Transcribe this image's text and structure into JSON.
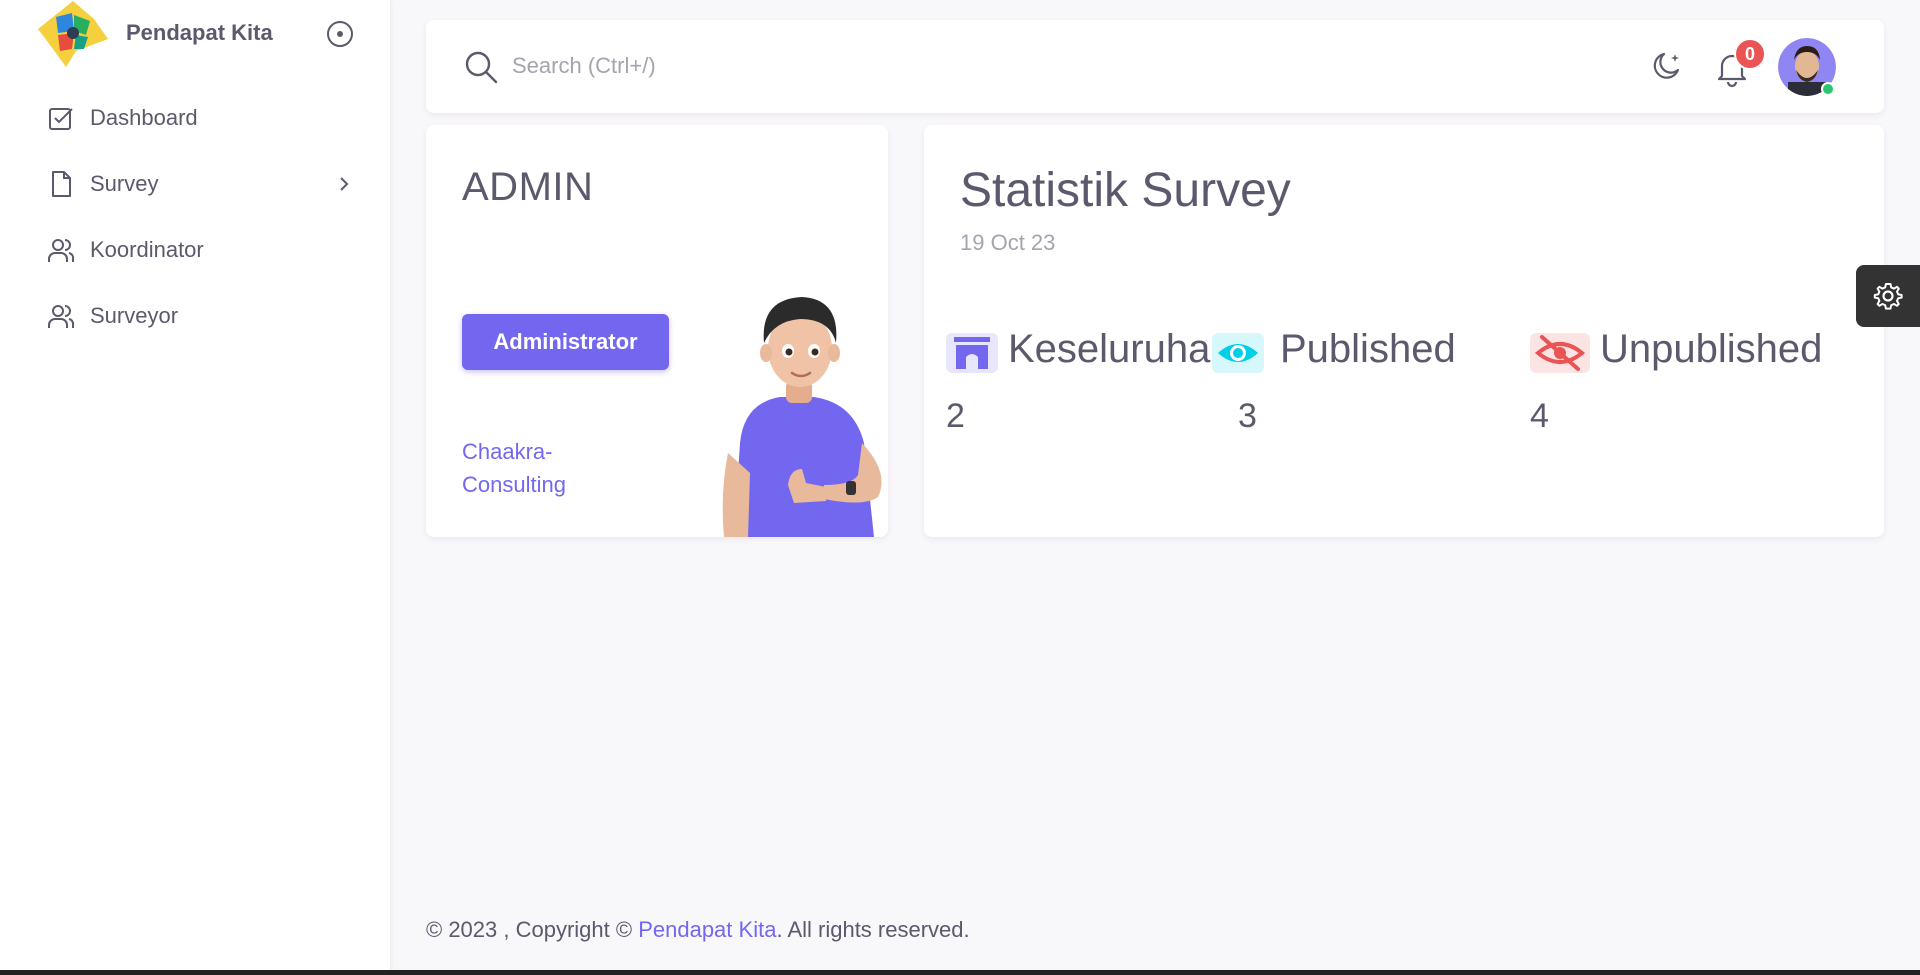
{
  "sidebar": {
    "brand_name": "Pendapat Kita",
    "items": [
      {
        "label": "Dashboard",
        "icon": "check-square-icon"
      },
      {
        "label": "Survey",
        "icon": "file-icon",
        "has_submenu": true
      },
      {
        "label": "Koordinator",
        "icon": "users-icon"
      },
      {
        "label": "Surveyor",
        "icon": "users-icon"
      }
    ]
  },
  "navbar": {
    "search_placeholder": "Search (Ctrl+/)",
    "notification_count": "0"
  },
  "admin_card": {
    "title": "ADMIN",
    "role_label": "Administrator",
    "organization": "Chaakra-Consulting"
  },
  "stats": {
    "title": "Statistik Survey",
    "date": "19 Oct 23",
    "items": [
      {
        "label": "Keseluruhan",
        "value": "2",
        "icon": "building-icon",
        "color": "#7367f0"
      },
      {
        "label": "Published",
        "value": "3",
        "icon": "eye-icon",
        "color": "#00cfe8"
      },
      {
        "label": "Unpublished",
        "value": "4",
        "icon": "eye-off-icon",
        "color": "#ea5455"
      }
    ]
  },
  "footer": {
    "prefix": "© 2023 , Copyright © ",
    "brand": "Pendapat Kita",
    "suffix": ". All rights reserved."
  },
  "colors": {
    "primary": "#7367f0",
    "info": "#00cfe8",
    "danger": "#ea5455",
    "success": "#28c76f",
    "text": "#5d596c",
    "muted": "#a5a3ae",
    "background": "#f8f7fa"
  }
}
